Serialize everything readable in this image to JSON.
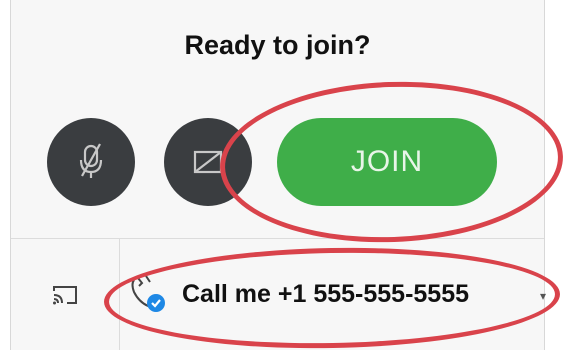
{
  "dialog": {
    "title": "Ready to join?"
  },
  "controls": {
    "mic_icon": "mic-muted-icon",
    "camera_icon": "camera-off-icon",
    "join_label": "JOIN",
    "join_color": "#3fae49",
    "button_color": "#3a3d40"
  },
  "audio": {
    "cast_icon": "cast-icon",
    "call_icon": "phone-check-icon",
    "call_label": "Call me +1 555-555-5555"
  },
  "annotation_color": "#d9434b"
}
